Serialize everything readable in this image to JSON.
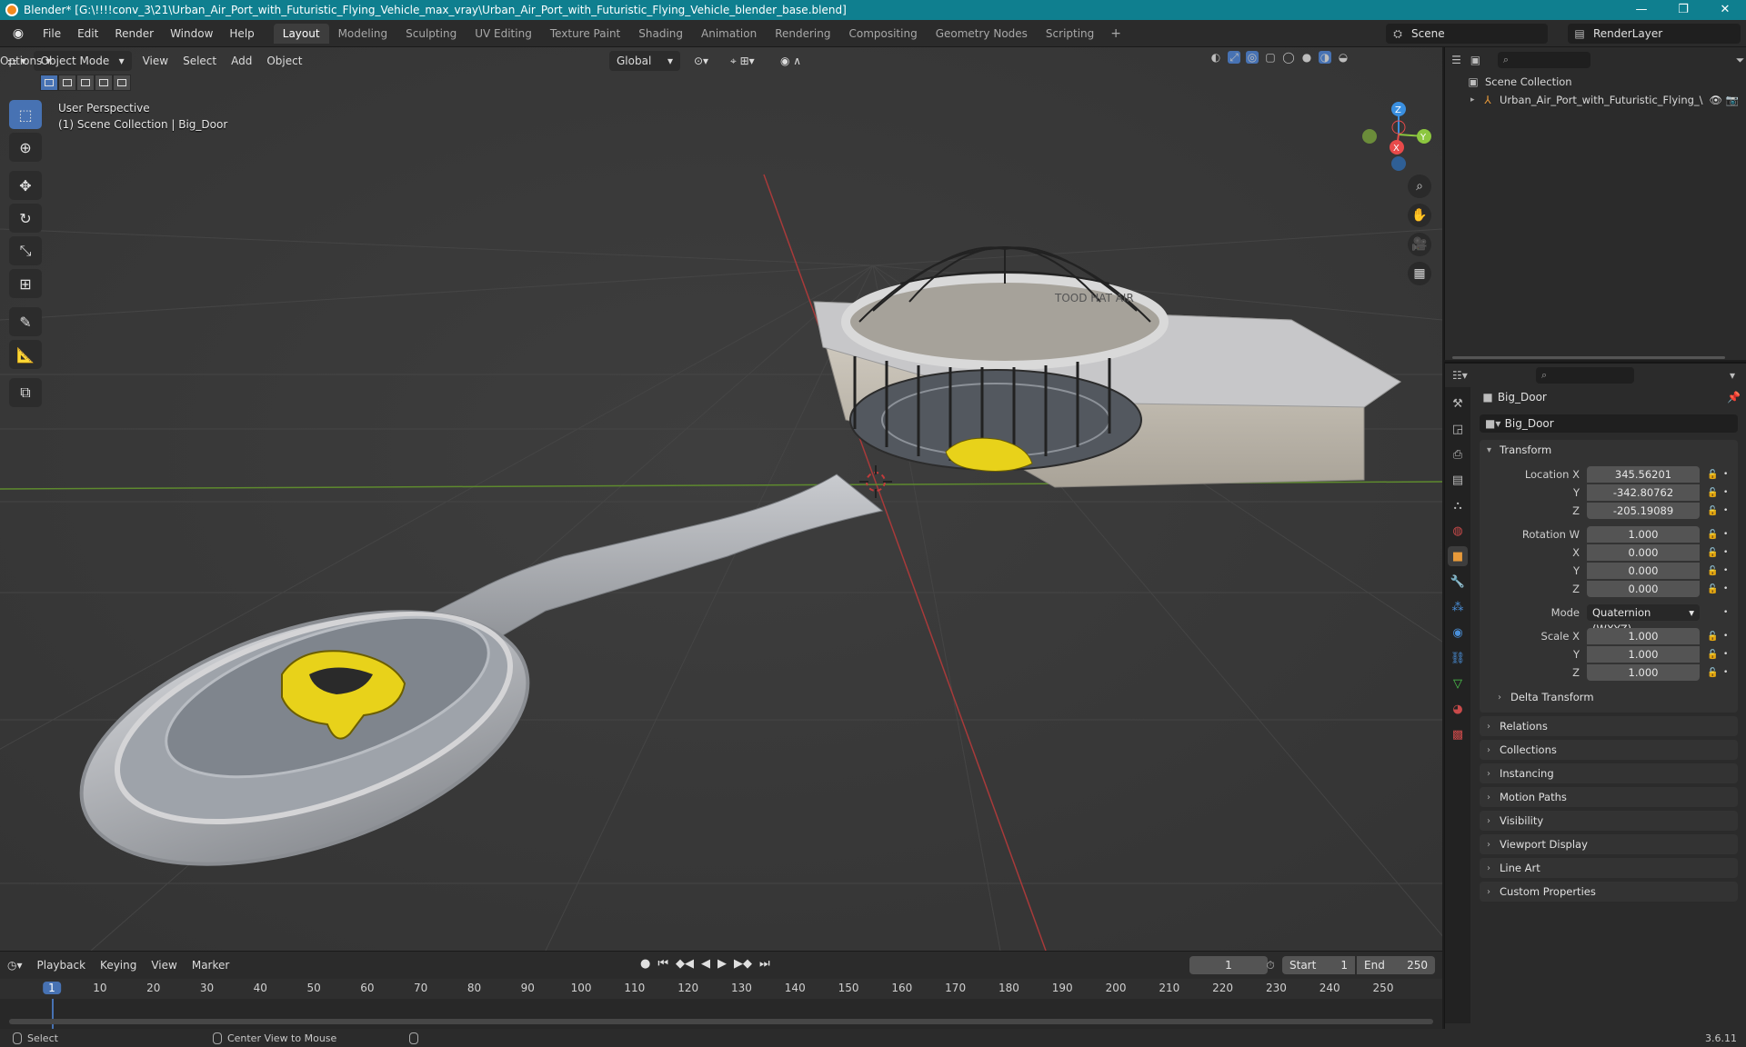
{
  "window": {
    "title": "Blender* [G:\\!!!!conv_3\\21\\Urban_Air_Port_with_Futuristic_Flying_Vehicle_max_vray\\Urban_Air_Port_with_Futuristic_Flying_Vehicle_blender_base.blend]",
    "minimize": "—",
    "maximize": "❐",
    "close": "✕"
  },
  "menu": [
    "File",
    "Edit",
    "Render",
    "Window",
    "Help"
  ],
  "workspaces": [
    "Layout",
    "Modeling",
    "Sculpting",
    "UV Editing",
    "Texture Paint",
    "Shading",
    "Animation",
    "Rendering",
    "Compositing",
    "Geometry Nodes",
    "Scripting"
  ],
  "active_workspace": "Layout",
  "scene": {
    "name": "Scene",
    "render_layer": "RenderLayer"
  },
  "viewport": {
    "mode": "Object Mode",
    "menus": [
      "View",
      "Select",
      "Add",
      "Object"
    ],
    "orientation": "Global",
    "options": "Options",
    "info_line1": "User Perspective",
    "info_line2": "(1) Scene Collection | Big_Door",
    "gizmo": {
      "z": "Z",
      "y": "Y",
      "x": "X"
    },
    "watermark": "TOOD HAT AIR"
  },
  "outliner": {
    "search_placeholder": "",
    "root": "Scene Collection",
    "items": [
      {
        "name": "Urban_Air_Port_with_Futuristic_Flying_\\"
      }
    ]
  },
  "properties": {
    "object_name": "Big_Door",
    "data_name": "Big_Door",
    "transform": {
      "title": "Transform",
      "location_label": "Location X",
      "location": {
        "x": "345.56201",
        "y": "-342.80762",
        "z": "-205.19089"
      },
      "rotation_label": "Rotation W",
      "rotation": {
        "w": "1.000",
        "x": "0.000",
        "y": "0.000",
        "z": "0.000"
      },
      "mode_label": "Mode",
      "mode": "Quaternion (WXYZ)",
      "scale_label": "Scale X",
      "scale": {
        "x": "1.000",
        "y": "1.000",
        "z": "1.000"
      },
      "y_label": "Y",
      "z_label": "Z",
      "x_label": "X",
      "delta": "Delta Transform"
    },
    "panels": [
      "Relations",
      "Collections",
      "Instancing",
      "Motion Paths",
      "Visibility",
      "Viewport Display",
      "Line Art",
      "Custom Properties"
    ]
  },
  "timeline": {
    "menus": [
      "Playback",
      "Keying",
      "View",
      "Marker"
    ],
    "current_frame": "1",
    "start_label": "Start",
    "start": "1",
    "end_label": "End",
    "end": "250",
    "ruler": [
      "1",
      "10",
      "20",
      "30",
      "40",
      "50",
      "60",
      "70",
      "80",
      "90",
      "100",
      "110",
      "120",
      "130",
      "140",
      "150",
      "160",
      "170",
      "180",
      "190",
      "200",
      "210",
      "220",
      "230",
      "240",
      "250"
    ]
  },
  "status": {
    "select": "Select",
    "center": "Center View to Mouse",
    "version": "3.6.11"
  },
  "colors": {
    "accent": "#4772b3",
    "titlebar": "#0f7f8f",
    "x_axis": "#e84a4a",
    "y_axis": "#8cc63f",
    "z_axis": "#3a8fe0",
    "vehicle": "#e8d21a"
  }
}
